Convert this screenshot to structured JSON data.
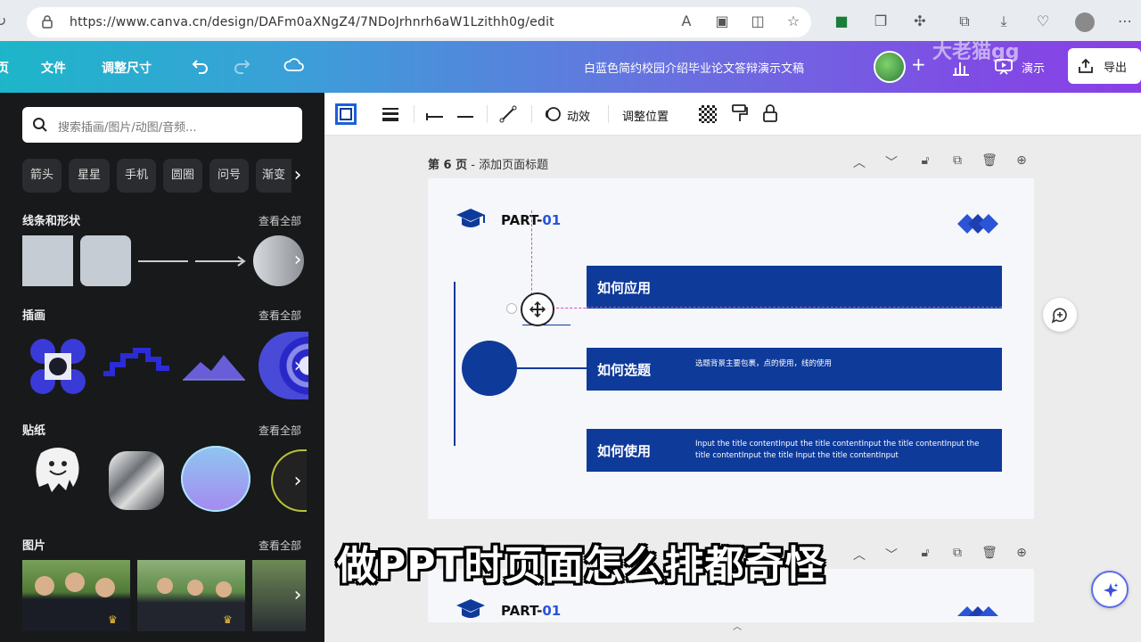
{
  "browser": {
    "url": "https://www.canva.cn/design/DAFm0aXNgZ4/7NDoJrhnrh6aW1Lzithh0g/edit",
    "watermark": "大老猫gg"
  },
  "header": {
    "menu_file": "文件",
    "menu_resize": "调整尺寸",
    "doc_title": "白蓝色简约校园介绍毕业论文答辩演示文稿",
    "present_label": "演示",
    "export_label": "导出"
  },
  "left_panel": {
    "search_placeholder": "搜索插画/图片/动图/音频...",
    "chips": [
      "箭头",
      "星星",
      "手机",
      "圆圈",
      "问号",
      "渐变"
    ],
    "sections": {
      "lines_shapes": "线条和形状",
      "illustrations": "插画",
      "stickers": "贴纸",
      "photos": "图片"
    },
    "see_all": "查看全部"
  },
  "toolbar": {
    "animate_label": "动效",
    "position_label": "调整位置"
  },
  "page": {
    "page_label_prefix": "第 6 页",
    "page_label_suffix": " - 添加页面标题"
  },
  "slide": {
    "part_label": "PART-",
    "part_number": "01",
    "bars": [
      {
        "title": "如何应用",
        "desc": ""
      },
      {
        "title": "如何选题",
        "desc": "选题背景主要包裹，点的使用，线的使用"
      },
      {
        "title": "如何使用",
        "desc": "Input the title contentInput the title contentInput the title contentInput the title contentInput the title Input the title contentInput"
      }
    ]
  },
  "slide2": {
    "part_label": "PART-",
    "part_number": "01"
  },
  "subtitle": "做PPT时页面怎么排都奇怪",
  "colors": {
    "slide_blue": "#0e3a9a",
    "accent_blue": "#2a55d6"
  }
}
